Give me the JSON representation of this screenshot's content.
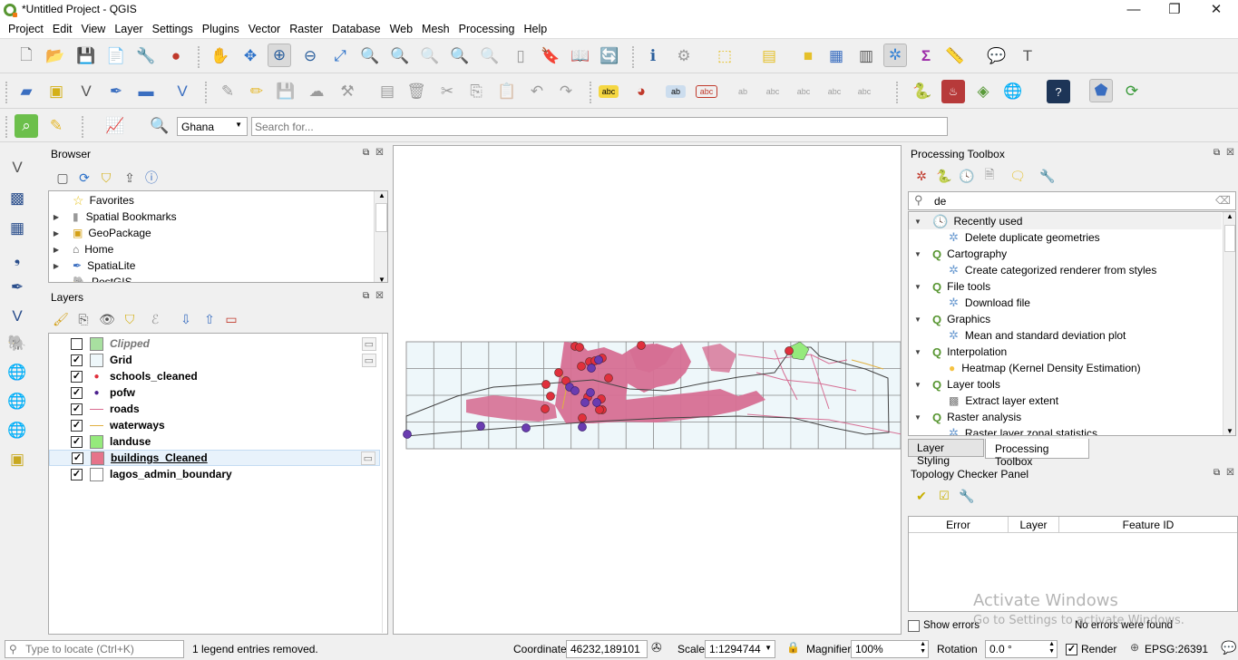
{
  "window": {
    "title": "*Untitled Project - QGIS",
    "minimize": "—",
    "maximize": "❐",
    "close": "✕"
  },
  "menu": [
    "Project",
    "Edit",
    "View",
    "Layer",
    "Settings",
    "Plugins",
    "Vector",
    "Raster",
    "Database",
    "Web",
    "Mesh",
    "Processing",
    "Help"
  ],
  "toolbar": {
    "locator_combo": "Ghana",
    "search_placeholder": "Search for..."
  },
  "browser": {
    "title": "Browser",
    "items": [
      {
        "label": "Favorites",
        "icon": "star-icon"
      },
      {
        "label": "Spatial Bookmarks",
        "icon": "bookmark-icon"
      },
      {
        "label": "GeoPackage",
        "icon": "geopackage-icon"
      },
      {
        "label": "Home",
        "icon": "home-icon"
      },
      {
        "label": "SpatiaLite",
        "icon": "feather-icon"
      },
      {
        "label": "PostGIS",
        "icon": "elephant-icon"
      }
    ]
  },
  "layers": {
    "title": "Layers",
    "items": [
      {
        "name": "Clipped",
        "checked": false,
        "symbol": "fill",
        "color": "#a8e0a0"
      },
      {
        "name": "Grid",
        "checked": true,
        "symbol": "fill",
        "color": "#eef7fa"
      },
      {
        "name": "schools_cleaned",
        "checked": true,
        "symbol": "point",
        "color": "#e0303c"
      },
      {
        "name": "pofw",
        "checked": true,
        "symbol": "point",
        "color": "#4b1f8e"
      },
      {
        "name": "roads",
        "checked": true,
        "symbol": "line",
        "color": "#d86a8e"
      },
      {
        "name": "waterways",
        "checked": true,
        "symbol": "line",
        "color": "#e0b040"
      },
      {
        "name": "landuse",
        "checked": true,
        "symbol": "fill",
        "color": "#95ea7c"
      },
      {
        "name": "buildings_Cleaned",
        "checked": true,
        "symbol": "fill",
        "color": "#e6738a"
      },
      {
        "name": "lagos_admin_boundary",
        "checked": true,
        "symbol": "fill",
        "color": "#ffffff"
      }
    ]
  },
  "processing": {
    "title": "Processing Toolbox",
    "search_value": "de",
    "groups": [
      {
        "name": "Recently used",
        "items": [
          "Delete duplicate geometries"
        ]
      },
      {
        "name": "Cartography",
        "items": [
          "Create categorized renderer from styles"
        ]
      },
      {
        "name": "File tools",
        "items": [
          "Download file"
        ]
      },
      {
        "name": "Graphics",
        "items": [
          "Mean and standard deviation plot"
        ]
      },
      {
        "name": "Interpolation",
        "items": [
          "Heatmap (Kernel Density Estimation)"
        ]
      },
      {
        "name": "Layer tools",
        "items": [
          "Extract layer extent"
        ]
      },
      {
        "name": "Raster analysis",
        "items": [
          "Raster layer zonal statistics"
        ]
      }
    ],
    "tabs": [
      "Layer Styling",
      "Processing Toolbox"
    ]
  },
  "topology": {
    "title": "Topology Checker Panel",
    "columns": [
      "Error",
      "Layer",
      "Feature ID"
    ],
    "show_errors_label": "Show errors",
    "status": "No errors were found"
  },
  "watermark": {
    "line1": "Activate Windows",
    "line2": "Go to Settings to activate Windows."
  },
  "status": {
    "locate_placeholder": "Type to locate (Ctrl+K)",
    "message": "1 legend entries removed.",
    "coordinate_label": "Coordinate",
    "coordinate": "46232,189101",
    "scale_label": "Scale",
    "scale": "1:1294744",
    "magnifier_label": "Magnifier",
    "magnifier": "100%",
    "rotation_label": "Rotation",
    "rotation": "0.0 °",
    "render_label": "Render",
    "render_checked": true,
    "crs": "EPSG:26391"
  }
}
